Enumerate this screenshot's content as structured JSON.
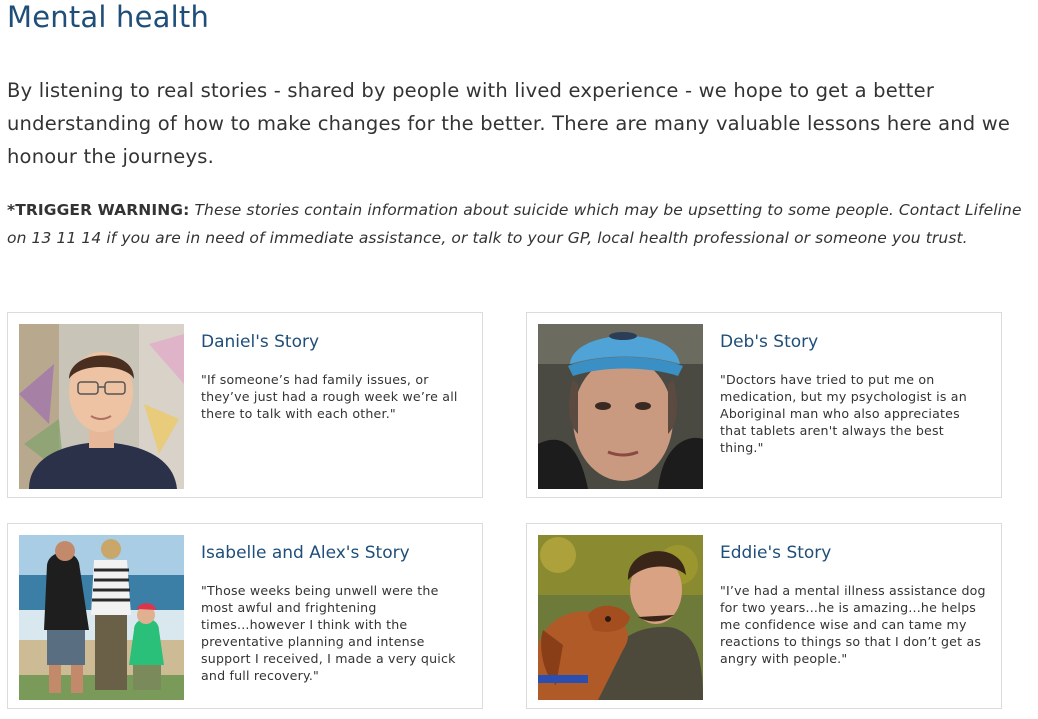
{
  "page": {
    "title": "Mental health",
    "intro": "By listening to real stories - shared by people with lived experience - we hope to get a better understanding of how to make changes for the better. There are many valuable lessons here and we honour the journeys.",
    "warning_label": "*TRIGGER WARNING:",
    "warning_text": "These stories contain information about suicide which may be upsetting to some people. Contact Lifeline on 13 11 14 if you are in need of immediate assistance, or talk to your GP, local health professional or someone you trust."
  },
  "stories": [
    {
      "title": "Daniel's Story",
      "quote": "\"If someone’s had family issues, or they’ve just had a rough week we’re all there to talk with each other.\""
    },
    {
      "title": "Deb's Story",
      "quote": "\"Doctors have tried to put me on medication, but my psychologist is an Aboriginal man who also appreciates that tablets aren't always the best thing.\""
    },
    {
      "title": "Isabelle and Alex's Story",
      "quote": "\"Those weeks being unwell were the most awful and frightening times...however I think with the preventative planning and intense support I received, I made a very quick and full recovery.\""
    },
    {
      "title": "Eddie's Story",
      "quote": "\"I’ve had a mental illness assistance dog for two years...he is amazing...he helps me confidence wise and can tame my reactions to things so that I don’t get as angry with people.\""
    }
  ],
  "colors": {
    "heading": "#1f4e79",
    "text": "#333333",
    "card_border": "#dcdcdc"
  }
}
